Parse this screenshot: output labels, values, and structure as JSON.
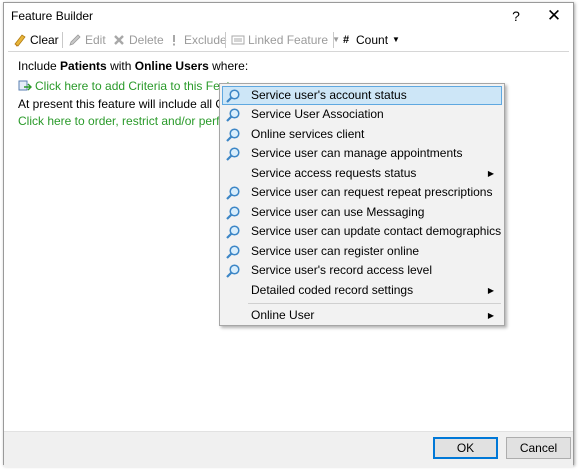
{
  "window": {
    "title": "Feature Builder",
    "help_label": "?",
    "close_label": "✕"
  },
  "toolbar": {
    "clear": "Clear",
    "edit": "Edit",
    "delete": "Delete",
    "exclude": "Exclude",
    "linked_feature": "Linked Feature",
    "count": "Count"
  },
  "content": {
    "include_prefix": "Include",
    "patients": "Patients",
    "with": "with",
    "online_users": "Online Users",
    "where": "where:",
    "add_criteria": "Click here to add Criteria to this Feature",
    "present_line": "At present this feature will include all Onli",
    "order_line": "Click here to order, restrict and/or perfor"
  },
  "menu": {
    "items": [
      {
        "label": "Service user's account status",
        "icon": "magnifier-icon",
        "selected": true
      },
      {
        "label": "Service User Association",
        "icon": "magnifier-icon"
      },
      {
        "label": "Online services client",
        "icon": "magnifier-icon"
      },
      {
        "label": "Service user can manage appointments",
        "icon": "magnifier-icon"
      },
      {
        "label": "Service access requests status",
        "submenu": true
      },
      {
        "label": "Service user can request repeat prescriptions",
        "icon": "magnifier-icon"
      },
      {
        "label": "Service user can use Messaging",
        "icon": "magnifier-icon"
      },
      {
        "label": "Service user can update contact demographics",
        "icon": "magnifier-icon"
      },
      {
        "label": "Service user can register online",
        "icon": "magnifier-icon"
      },
      {
        "label": "Service user's record access level",
        "icon": "magnifier-icon"
      },
      {
        "label": "Detailed coded record settings",
        "submenu": true
      },
      {
        "label": "Online User",
        "submenu": true
      }
    ]
  },
  "footer": {
    "ok": "OK",
    "cancel": "Cancel"
  },
  "colors": {
    "link_green": "#2a9a2a",
    "selection_bg": "#cde6f7",
    "selection_border": "#5fa8e0",
    "primary_button_border": "#0078d7"
  }
}
